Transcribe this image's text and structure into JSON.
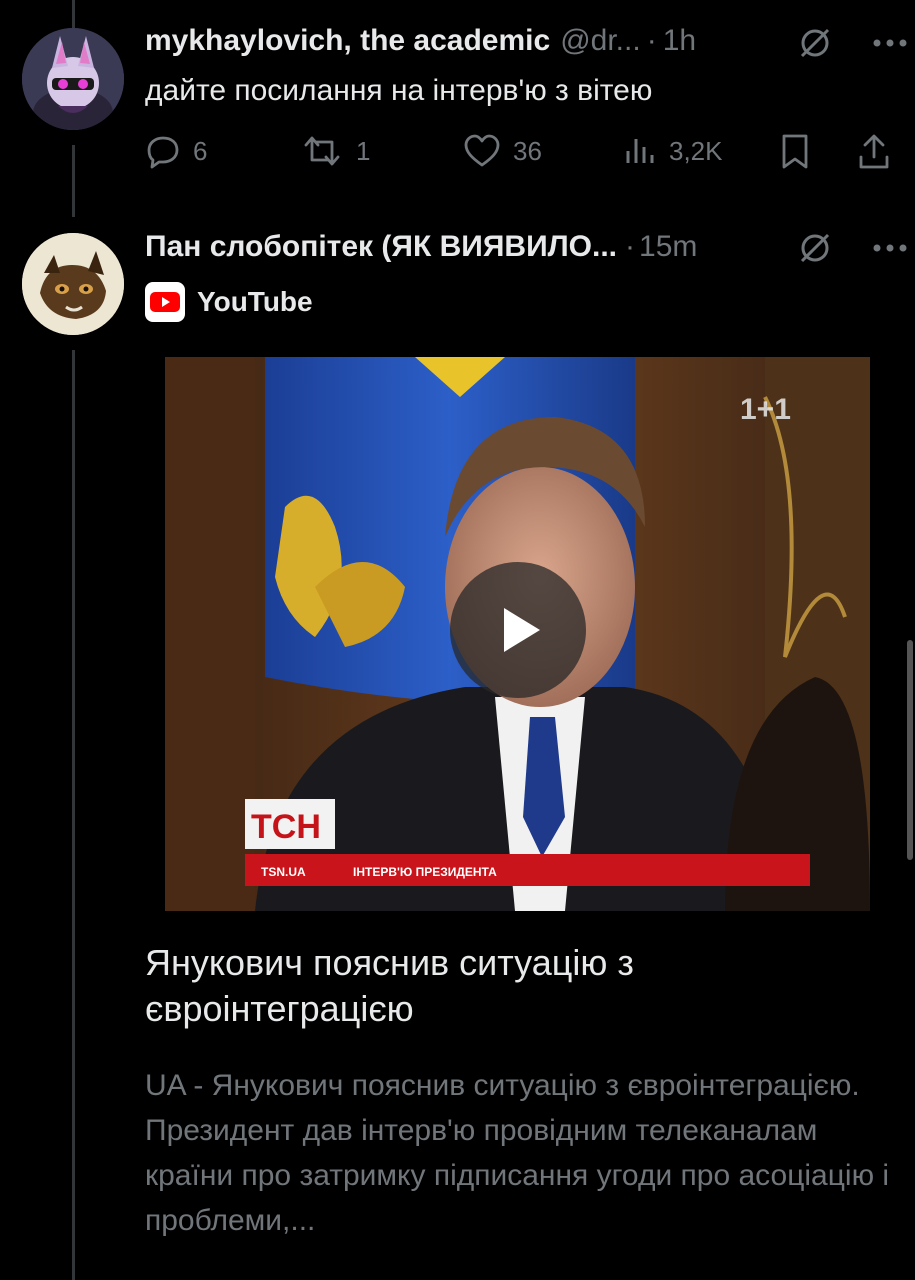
{
  "tweet1": {
    "name": "mykhaylovich, the academic",
    "handle": "@dr...",
    "time": "1h",
    "text": "дайте посилання на інтерв'ю з вітею",
    "replies": "6",
    "reposts": "1",
    "likes": "36",
    "views": "3,2K"
  },
  "tweet2": {
    "name": "Пан слобопітек (ЯК ВИЯВИЛО...",
    "time": "15m",
    "card": {
      "source": "YouTube",
      "video_overlay": {
        "channel_logo": "1+1",
        "tsn_logo": "ТСН",
        "ticker_site": "TSN.UA",
        "ticker_text": "ІНТЕРВ'Ю ПРЕЗИДЕНТА"
      },
      "title": "Янукович пояснив ситуацію з євроінтеграцією",
      "description": "UA - Янукович пояснив ситуацію з євроінтеграцією. Президент дав інтерв'ю провідним телеканалам країни про затримку підписання угоди про асоціацію і проблеми,..."
    }
  },
  "icons": {
    "grok": "grok-icon",
    "more": "more-icon",
    "reply": "reply-icon",
    "repost": "repost-icon",
    "like": "heart-icon",
    "views": "views-icon",
    "bookmark": "bookmark-icon",
    "share": "share-icon",
    "play": "play-icon",
    "youtube": "youtube-icon"
  },
  "colors": {
    "background": "#000000",
    "text_primary": "#e7e9ea",
    "text_secondary": "#71767b",
    "youtube_red": "#ff0000"
  }
}
